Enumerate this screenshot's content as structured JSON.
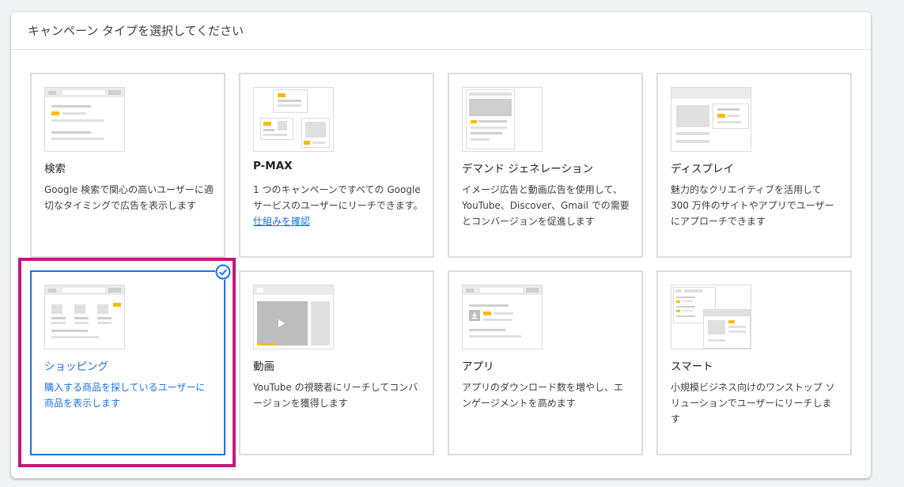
{
  "header": {
    "title": "キャンペーン タイプを選択してください"
  },
  "cards": [
    {
      "title": "検索",
      "desc": "Google 検索で関心の高いユーザーに適切なタイミングで広告を表示します"
    },
    {
      "title": "P-MAX",
      "desc": "1 つのキャンペーンですべての Google サービスのユーザーにリーチできます。",
      "link": "仕組みを確認"
    },
    {
      "title": "デマンド ジェネレーション",
      "desc": "イメージ広告と動画広告を使用して、YouTube、Discover、Gmail での需要とコンバージョンを促進します"
    },
    {
      "title": "ディスプレイ",
      "desc": "魅力的なクリエイティブを活用して 300 万件のサイトやアプリでユーザーにアプローチできます"
    },
    {
      "title": "ショッピング",
      "desc": "購入する商品を探しているユーザーに商品を表示します",
      "selected": true
    },
    {
      "title": "動画",
      "desc": "YouTube の視聴者にリーチしてコンバージョンを獲得します"
    },
    {
      "title": "アプリ",
      "desc": "アプリのダウンロード数を増やし、エンゲージメントを高めます"
    },
    {
      "title": "スマート",
      "desc": "小規模ビジネス向けのワンストップ ソリューションでユーザーにリーチします"
    }
  ],
  "colors": {
    "accent": "#1a73e8",
    "highlight": "#c2187a",
    "thumbnail_accent": "#fbbc04"
  },
  "icons": {
    "selected": "check-circle-icon"
  }
}
